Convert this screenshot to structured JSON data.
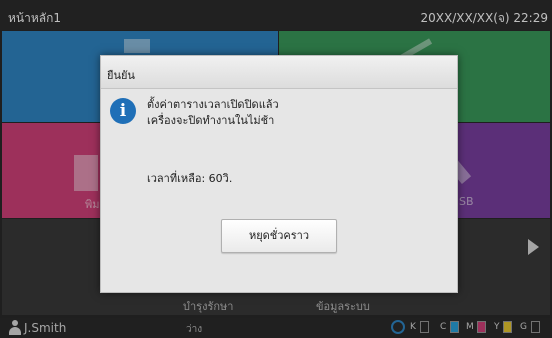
{
  "header": {
    "title": "หน้าหลัก1",
    "datetime": "20XX/XX/XX(จ) 22:29"
  },
  "tiles": {
    "pink_label": "พิม",
    "purple_label": "SB"
  },
  "bottom_tabs": {
    "maintenance": "บำรุงรักษา",
    "system_info": "ข้อมูลระบบ"
  },
  "status": {
    "user": "J.Smith",
    "state": "ว่าง",
    "inks": [
      {
        "label": "K",
        "color": "#ffffff"
      },
      {
        "label": "C",
        "color": "#2aa3dd"
      },
      {
        "label": "M",
        "color": "#d2407a"
      },
      {
        "label": "Y",
        "color": "#e8c830"
      },
      {
        "label": "G",
        "color": "#ffffff"
      }
    ]
  },
  "dialog": {
    "title": "ยืนยัน",
    "message_line1": "ตั้งค่าตารางเวลาเปิดปิดแล้ว",
    "message_line2": "เครื่องจะปิดทำงานในไม่ช้า",
    "remaining": "เวลาที่เหลือ: 60วิ.",
    "pause_button": "หยุดชั่วคราว"
  },
  "colors": {
    "blue_tile": "#2f86c4",
    "green_tile": "#3a9a5b",
    "pink_tile": "#d2407a",
    "purple_tile": "#7a3fa0"
  }
}
